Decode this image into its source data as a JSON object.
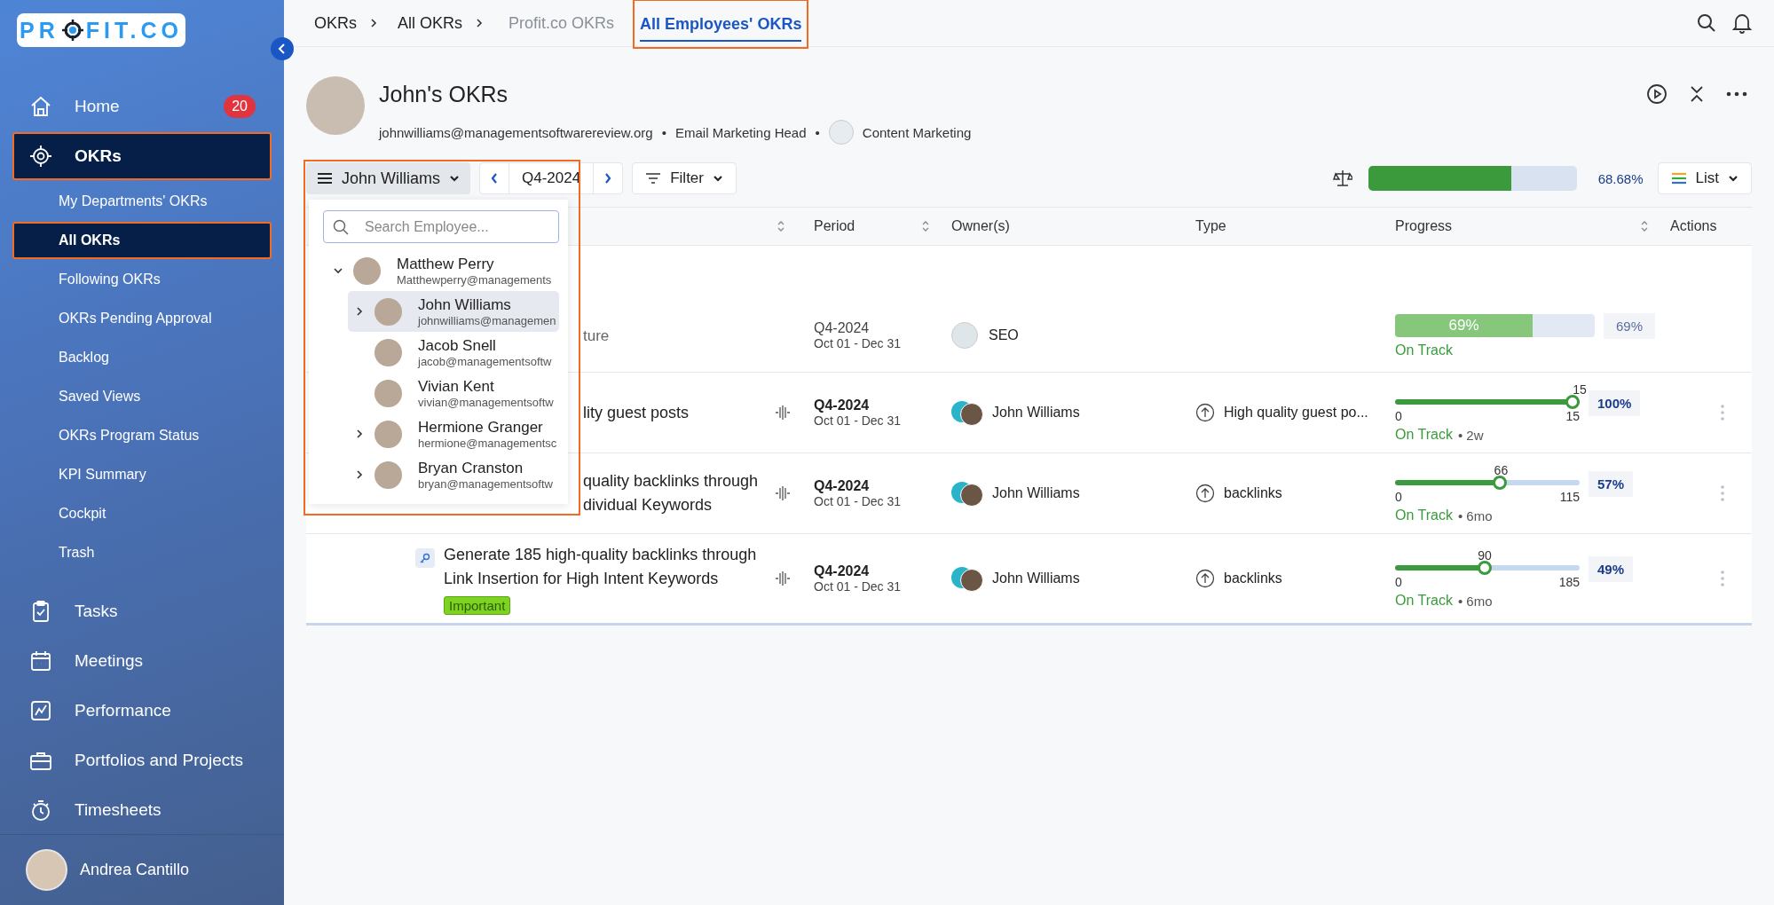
{
  "sidebar": {
    "logo": {
      "before": "PR",
      "after": "FIT.CO"
    },
    "items": [
      {
        "label": "Home",
        "badge": "20",
        "selected": false
      },
      {
        "label": "OKRs",
        "selected": true,
        "children": [
          {
            "label": "My Departments' OKRs",
            "selected": false
          },
          {
            "label": "All OKRs",
            "selected": true
          },
          {
            "label": "Following OKRs",
            "selected": false
          },
          {
            "label": "OKRs Pending Approval",
            "selected": false
          },
          {
            "label": "Backlog",
            "selected": false
          },
          {
            "label": "Saved Views",
            "selected": false
          },
          {
            "label": "OKRs Program Status",
            "selected": false
          },
          {
            "label": "KPI Summary",
            "selected": false
          },
          {
            "label": "Cockpit",
            "selected": false
          },
          {
            "label": "Trash",
            "selected": false
          }
        ]
      },
      {
        "label": "Tasks",
        "selected": false
      },
      {
        "label": "Meetings",
        "selected": false
      },
      {
        "label": "Performance",
        "selected": false
      },
      {
        "label": "Portfolios and Projects",
        "selected": false
      },
      {
        "label": "Timesheets",
        "selected": false
      }
    ],
    "user": {
      "name": "Andrea Cantillo"
    }
  },
  "breadcrumb": [
    "OKRs",
    "All OKRs"
  ],
  "tabs": [
    {
      "label": "Profit.co OKRs",
      "selected": false
    },
    {
      "label": "All Employees' OKRs",
      "selected": true
    }
  ],
  "profile": {
    "title": "John's OKRs",
    "email": "johnwilliams@managementsoftwarereview.org",
    "separator": "•",
    "role": "Email Marketing Head",
    "department": "Content Marketing"
  },
  "toolbar": {
    "employee": "John Williams",
    "period": "Q4-2024",
    "filter": "Filter",
    "overall": {
      "level": 0.6868,
      "reading": "68.68%"
    },
    "view": "List"
  },
  "employee_dropdown": {
    "placeholder": "Search Employee...",
    "tree": [
      {
        "name": "Matthew Perry",
        "email": "Matthewperry@managements",
        "expanded": true,
        "selected": false,
        "children": [
          {
            "name": "John Williams",
            "email": "johnwilliams@managemen",
            "expanded": false,
            "selected": true
          },
          {
            "name": "Jacob Snell",
            "email": "jacob@managementsoftw",
            "selected": false
          },
          {
            "name": "Vivian Kent",
            "email": "vivian@managementsoftw",
            "selected": false
          },
          {
            "name": "Hermione Granger",
            "email": "hermione@managementsc",
            "expanded": false,
            "selected": false
          },
          {
            "name": "Bryan Cranston",
            "email": "bryan@managementsoftw",
            "expanded": false,
            "selected": false
          }
        ]
      }
    ]
  },
  "table": {
    "columns": [
      "Period",
      "Owner(s)",
      "Type",
      "Progress",
      "Actions"
    ],
    "rows": [
      {
        "kind": "objective",
        "title": "ture",
        "period": "Q4-2024",
        "dates": "Oct 01 - Dec 31",
        "owner": "SEO",
        "progress": {
          "level": 0.69,
          "label": "69%",
          "percent": "69%",
          "status": "On Track"
        }
      },
      {
        "kind": "key_result",
        "title": "lity guest posts",
        "period": "Q4-2024",
        "dates": "Oct 01 - Dec 31",
        "owner": "John Williams",
        "type": "High quality guest po...",
        "progress": {
          "level": 1.0,
          "current": "15",
          "start": "0",
          "end": "15",
          "percent": "100%",
          "status": "On Track",
          "age": "• 2w"
        }
      },
      {
        "kind": "key_result",
        "title": "quality backlinks through dividual Keywords",
        "period": "Q4-2024",
        "dates": "Oct 01 - Dec 31",
        "owner": "John Williams",
        "type": "backlinks",
        "progress": {
          "level": 0.574,
          "current": "66",
          "start": "0",
          "end": "115",
          "percent": "57%",
          "status": "On Track",
          "age": "• 6mo"
        }
      },
      {
        "kind": "key_result",
        "title_icon": true,
        "title": "Generate 185 high-quality backlinks through Link Insertion for High Intent Keywords",
        "tag": "Important",
        "period": "Q4-2024",
        "dates": "Oct 01 - Dec 31",
        "owner": "John Williams",
        "type": "backlinks",
        "progress": {
          "level": 0.486,
          "current": "90",
          "start": "0",
          "end": "185",
          "percent": "49%",
          "status": "On Track",
          "age": "• 6mo"
        }
      }
    ]
  }
}
